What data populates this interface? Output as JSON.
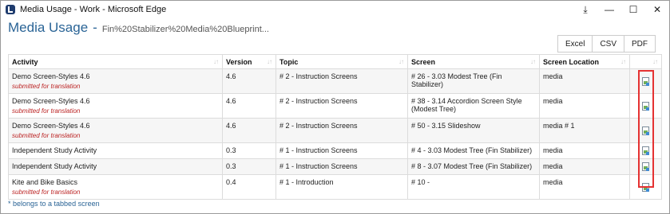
{
  "window": {
    "title": "Media Usage - Work - Microsoft Edge",
    "controls": {
      "download": "⤓",
      "minimize": "—",
      "maximize": "☐",
      "close": "✕"
    }
  },
  "header": {
    "title": "Media Usage",
    "separator": "-",
    "subtitle": "Fin%20Stabilizer%20Media%20Blueprint..."
  },
  "export": {
    "excel": "Excel",
    "csv": "CSV",
    "pdf": "PDF"
  },
  "table": {
    "columns": [
      "Activity",
      "Version",
      "Topic",
      "Screen",
      "Screen Location",
      ""
    ],
    "sort_glyph": "↓↑",
    "rows": [
      {
        "activity": "Demo Screen-Styles 4.6",
        "note": "submitted for translation",
        "version": "4.6",
        "topic": "# 2 - Instruction Screens",
        "screen": "# 26 - 3.03 Modest Tree (Fin Stabilizer)",
        "location": "media"
      },
      {
        "activity": "Demo Screen-Styles 4.6",
        "note": "submitted for translation",
        "version": "4.6",
        "topic": "# 2 - Instruction Screens",
        "screen": "# 38 - 3.14 Accordion Screen Style (Modest Tree)",
        "location": "media"
      },
      {
        "activity": "Demo Screen-Styles 4.6",
        "note": "submitted for translation",
        "version": "4.6",
        "topic": "# 2 - Instruction Screens",
        "screen": "# 50 - 3.15 Slideshow",
        "location": "media # 1"
      },
      {
        "activity": "Independent Study Activity",
        "note": "",
        "version": "0.3",
        "topic": "# 1 - Instruction Screens",
        "screen": "# 4 - 3.03 Modest Tree (Fin Stabilizer)",
        "location": "media"
      },
      {
        "activity": "Independent Study Activity",
        "note": "",
        "version": "0.3",
        "topic": "# 1 - Instruction Screens",
        "screen": "# 8 - 3.07 Modest Tree (Fin Stabilizer)",
        "location": "media"
      },
      {
        "activity": "Kite and Bike Basics",
        "note": "submitted for translation",
        "version": "0.4",
        "topic": "# 1 - Introduction",
        "screen": "# 10 -",
        "location": "media"
      }
    ]
  },
  "footer": {
    "note": "* belongs to a tabbed screen"
  },
  "colors": {
    "title": "#2a6496",
    "note": "#b22222",
    "highlight": "#e53232"
  }
}
